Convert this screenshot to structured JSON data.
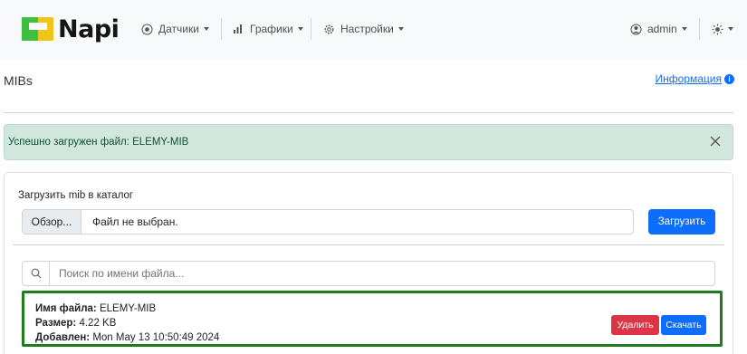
{
  "brand": {
    "name": "Napi",
    "logo_icon": "napi-logo-icon",
    "colors": {
      "green": "#3fbf3f",
      "yellow": "#f0c419"
    }
  },
  "nav": {
    "items": [
      {
        "label": "Датчики",
        "icon": "sensor-icon"
      },
      {
        "label": "Графики",
        "icon": "chart-icon"
      },
      {
        "label": "Настройки",
        "icon": "gear-icon"
      }
    ],
    "user": {
      "label": "admin",
      "icon": "user-circle-icon"
    },
    "theme": {
      "icon": "sun-icon"
    }
  },
  "page": {
    "title": "MIBs",
    "info_link": "Информация",
    "info_icon": "info-icon"
  },
  "alert": {
    "text": "Успешно загружен файл: ELEMY-MIB",
    "color": "#d1e7dd"
  },
  "upload": {
    "label": "Загрузить mib в каталог",
    "browse_label": "Обзор...",
    "file_status": "Файл не выбран.",
    "submit_label": "Загрузить"
  },
  "search": {
    "placeholder": "Поиск по имени файла..."
  },
  "files": [
    {
      "name_label": "Имя файла:",
      "name": "ELEMY-MIB",
      "size_label": "Размер:",
      "size": "4.22 KB",
      "added_label": "Добавлен:",
      "added": "Mon May 13 10:50:49 2024",
      "delete_label": "Удалить",
      "download_label": "Скачать"
    }
  ],
  "colors": {
    "primary": "#0d6efd",
    "danger": "#dc3545",
    "highlight_border": "#1e7d1e"
  }
}
